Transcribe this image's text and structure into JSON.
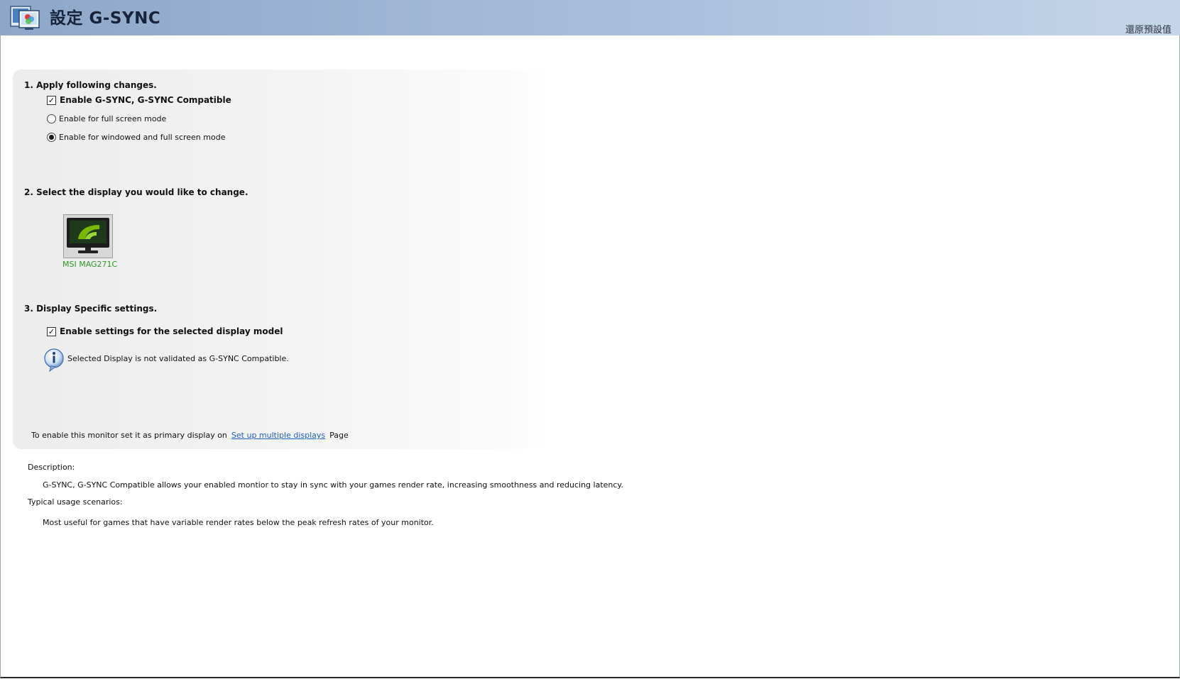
{
  "header": {
    "title": "設定 G-SYNC",
    "restore_defaults": "還原預設值",
    "app_icon": "nvidia-control-panel-icon"
  },
  "section1": {
    "title": "1. Apply following changes.",
    "enable_gsync": {
      "label": "Enable G-SYNC, G-SYNC Compatible",
      "checked": true
    },
    "mode_options": [
      {
        "label": "Enable for full screen mode",
        "selected": false
      },
      {
        "label": "Enable for windowed and full screen mode",
        "selected": true
      }
    ]
  },
  "section2": {
    "title": "2. Select the display you would like to change.",
    "display": {
      "name": "MSI MAG271C",
      "icon": "nvidia-monitor-icon",
      "label_color": "#2b9a24"
    }
  },
  "section3": {
    "title": "3. Display Specific settings.",
    "enable_display_settings": {
      "label": "Enable settings for the selected display model",
      "checked": true
    },
    "info": {
      "icon": "info-icon",
      "text": "Selected Display is not validated as G-SYNC Compatible."
    }
  },
  "primary_display": {
    "prefix": "To enable this monitor set it as primary display on",
    "link": "Set up multiple displays",
    "suffix": "Page"
  },
  "description": {
    "label": "Description:",
    "text": "G-SYNC, G-SYNC Compatible allows your enabled montior to stay in sync with your games render rate, increasing smoothness and reducing latency.",
    "usage_label": "Typical usage scenarios:",
    "usage_text": "Most useful for games that have variable render rates below the peak refresh rates of your monitor."
  },
  "colors": {
    "header_gradient_start": "#8ea7c8",
    "header_gradient_end": "#c6d6ea",
    "link": "#1f5fbf",
    "display_label": "#2b9a24",
    "nvidia_green": "#76b900"
  }
}
